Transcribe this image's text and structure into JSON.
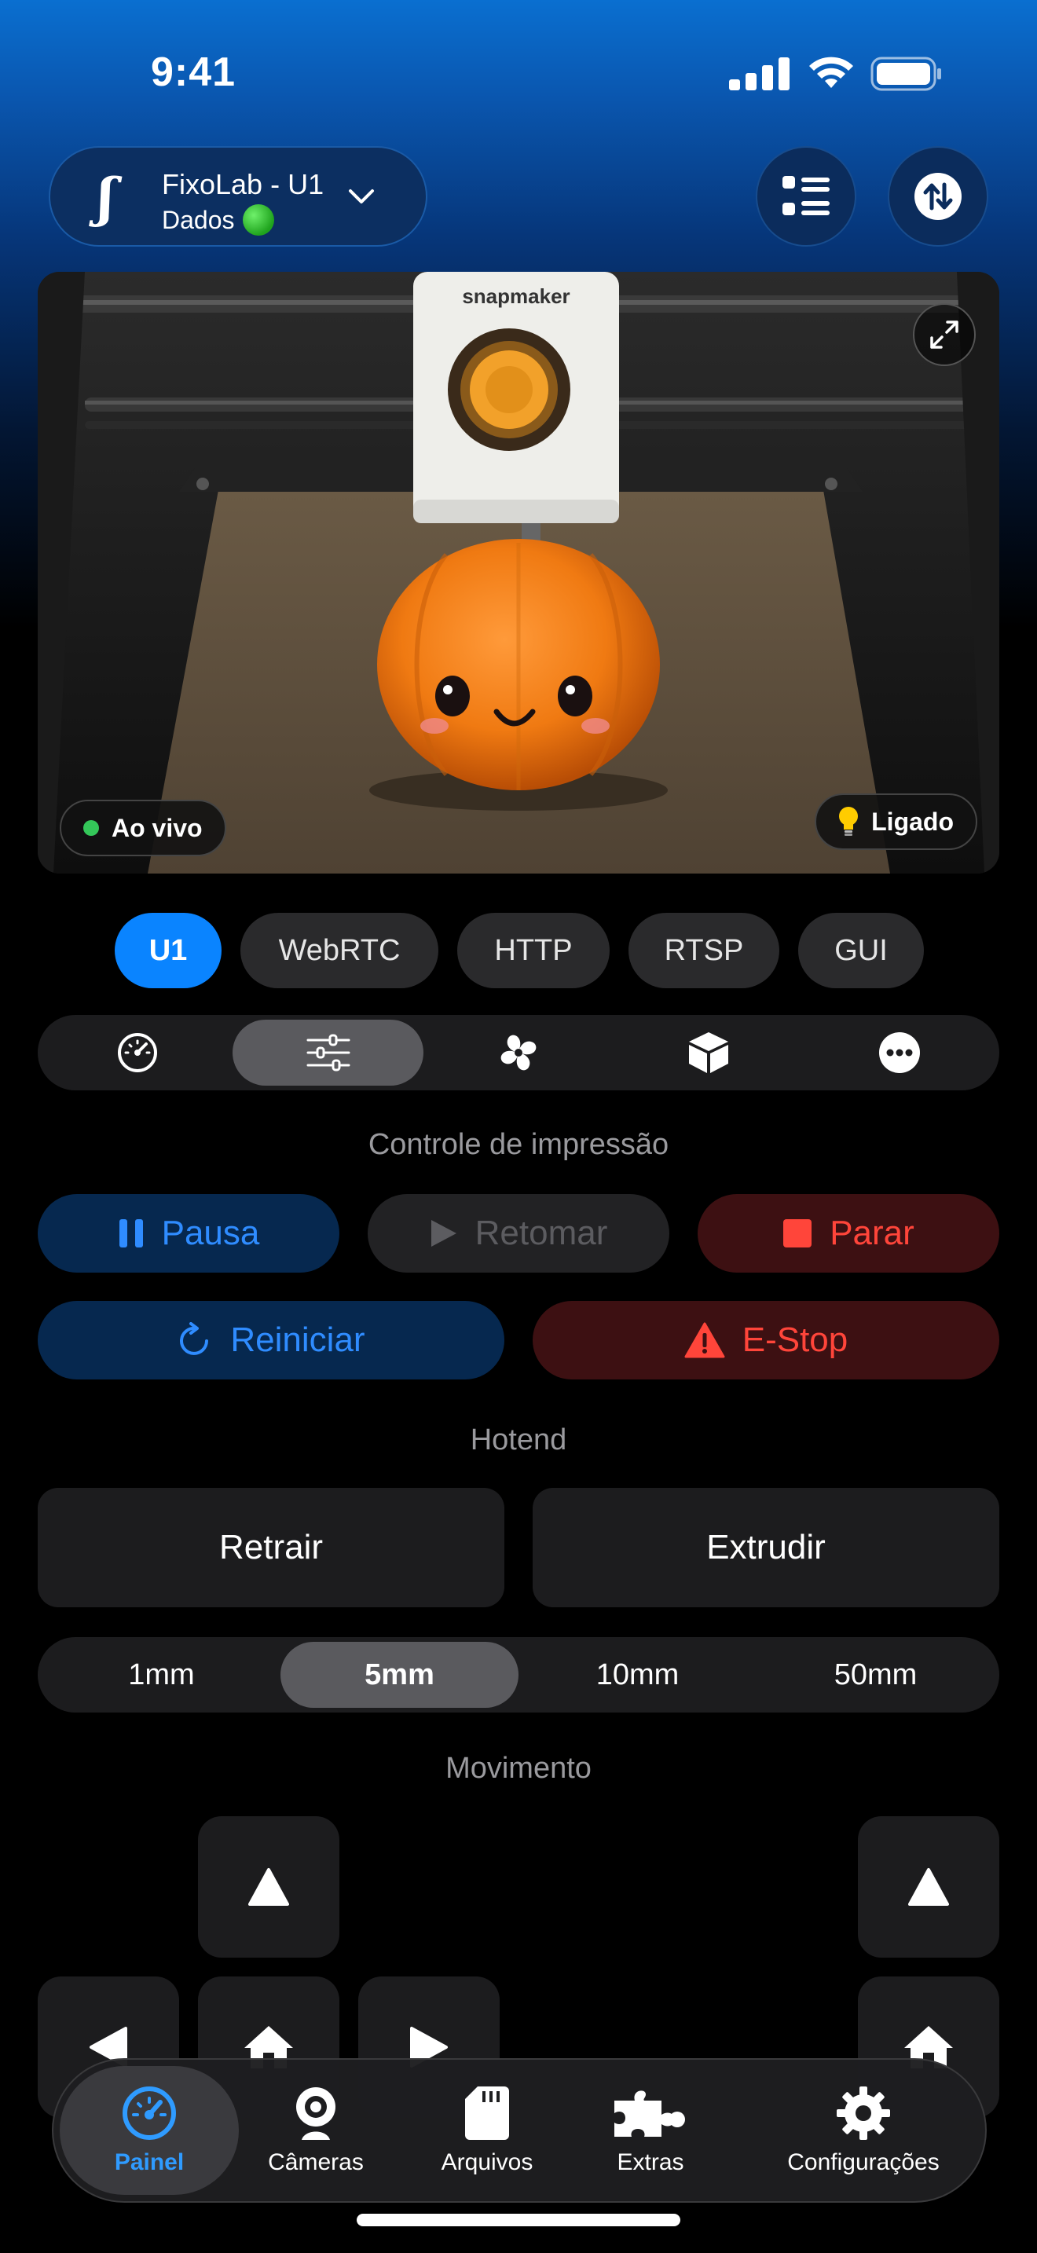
{
  "status_bar": {
    "time": "9:41"
  },
  "header": {
    "printer_name": "FixoLab - U1",
    "printer_sub": "Dados"
  },
  "camera": {
    "brand": "snapmaker",
    "live_label": "Ao vivo",
    "light_label": "Ligado"
  },
  "source_tabs": [
    {
      "label": "U1",
      "active": true
    },
    {
      "label": "WebRTC",
      "active": false
    },
    {
      "label": "HTTP",
      "active": false
    },
    {
      "label": "RTSP",
      "active": false
    },
    {
      "label": "GUI",
      "active": false
    }
  ],
  "section_tabs": [
    {
      "icon": "gauge-icon",
      "active": false
    },
    {
      "icon": "sliders-icon",
      "active": true
    },
    {
      "icon": "fan-icon",
      "active": false
    },
    {
      "icon": "cube-icon",
      "active": false
    },
    {
      "icon": "more-icon",
      "active": false
    }
  ],
  "print_control": {
    "title": "Controle de impressão",
    "pause_label": "Pausa",
    "resume_label": "Retomar",
    "stop_label": "Parar",
    "restart_label": "Reiniciar",
    "estop_label": "E-Stop"
  },
  "hotend": {
    "title": "Hotend",
    "retract_label": "Retrair",
    "extrude_label": "Extrudir",
    "distances": [
      "1mm",
      "5mm",
      "10mm",
      "50mm"
    ],
    "selected_distance": "5mm"
  },
  "movement": {
    "title": "Movimento"
  },
  "bottom_nav": [
    {
      "label": "Painel",
      "icon": "dashboard-gauge-icon",
      "active": true
    },
    {
      "label": "Câmeras",
      "icon": "webcam-icon",
      "active": false
    },
    {
      "label": "Arquivos",
      "icon": "sd-card-icon",
      "active": false
    },
    {
      "label": "Extras",
      "icon": "puzzle-icon",
      "active": false
    },
    {
      "label": "Configurações",
      "icon": "gear-icon",
      "active": false
    }
  ],
  "colors": {
    "accent": "#0a84ff",
    "danger": "#ff453a",
    "header_gradient_top": "#0a6fd0"
  }
}
